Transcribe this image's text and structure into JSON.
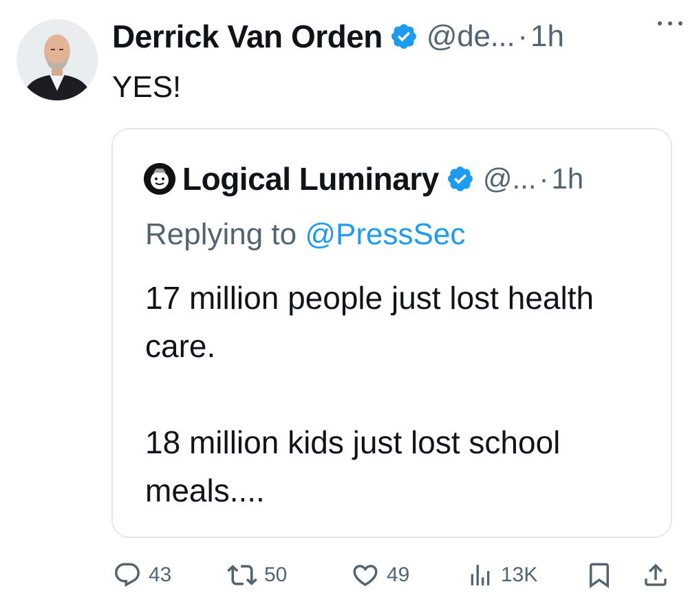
{
  "tweet": {
    "author": {
      "name": "Derrick Van Orden",
      "handle": "@de...",
      "verified": true,
      "avatar_icon": "profile-photo"
    },
    "time": "1h",
    "separator": "·",
    "text": "YES!",
    "more_icon": "more-horizontal-icon"
  },
  "quote": {
    "author": {
      "name": "Logical Luminary",
      "handle": "@...",
      "verified": true,
      "avatar_icon": "cartoon-face-avatar"
    },
    "time": "1h",
    "separator": "·",
    "replying_prefix": "Replying to",
    "replying_mention": "@PressSec",
    "body": [
      "17 million people just lost health care.",
      "18 million kids just lost school meals...."
    ]
  },
  "actions": {
    "replies": "43",
    "reposts": "50",
    "likes": "49",
    "views": "13K"
  },
  "colors": {
    "text": "#0f1419",
    "secondary": "#536471",
    "accent": "#1d9bf0",
    "border": "#e1e8ed"
  }
}
